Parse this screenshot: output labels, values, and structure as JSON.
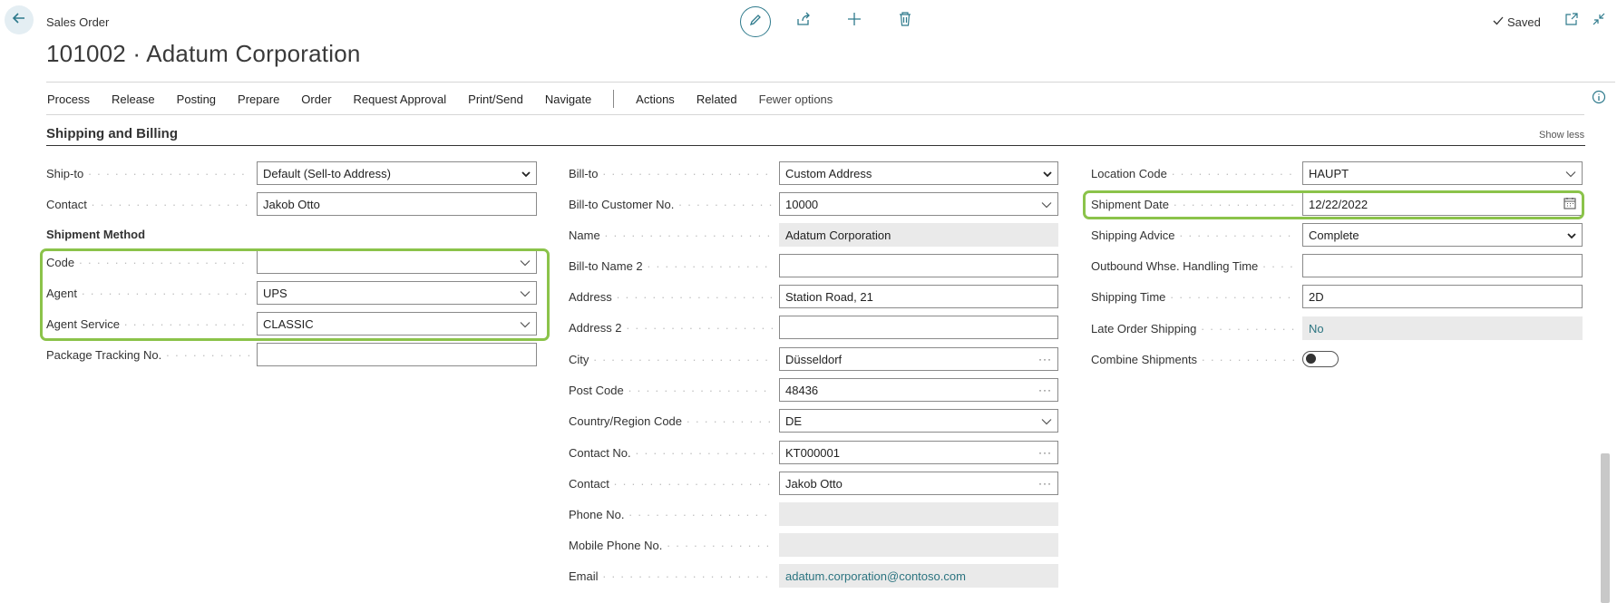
{
  "header": {
    "breadcrumb": "Sales Order",
    "title": "101002 · Adatum Corporation",
    "saved_label": "Saved"
  },
  "actions": {
    "items": [
      "Process",
      "Release",
      "Posting",
      "Prepare",
      "Order",
      "Request Approval",
      "Print/Send",
      "Navigate"
    ],
    "secondary": [
      "Actions",
      "Related",
      "Fewer options"
    ]
  },
  "section": {
    "title": "Shipping and Billing",
    "toggle_label": "Show less"
  },
  "col1": {
    "ship_to_label": "Ship-to",
    "ship_to_value": "Default (Sell-to Address)",
    "contact_label": "Contact",
    "contact_value": "Jakob Otto",
    "shipment_method_header": "Shipment Method",
    "code_label": "Code",
    "code_value": "",
    "agent_label": "Agent",
    "agent_value": "UPS",
    "agent_service_label": "Agent Service",
    "agent_service_value": "CLASSIC",
    "package_tracking_label": "Package Tracking No.",
    "package_tracking_value": ""
  },
  "col2": {
    "bill_to_label": "Bill-to",
    "bill_to_value": "Custom Address",
    "customer_no_label": "Bill-to Customer No.",
    "customer_no_value": "10000",
    "name_label": "Name",
    "name_value": "Adatum Corporation",
    "name2_label": "Bill-to Name 2",
    "name2_value": "",
    "address_label": "Address",
    "address_value": "Station Road, 21",
    "address2_label": "Address 2",
    "address2_value": "",
    "city_label": "City",
    "city_value": "Düsseldorf",
    "post_code_label": "Post Code",
    "post_code_value": "48436",
    "country_label": "Country/Region Code",
    "country_value": "DE",
    "contact_no_label": "Contact No.",
    "contact_no_value": "KT000001",
    "contact_label": "Contact",
    "contact_value": "Jakob Otto",
    "phone_label": "Phone No.",
    "phone_value": "",
    "mobile_label": "Mobile Phone No.",
    "mobile_value": "",
    "email_label": "Email",
    "email_value": "adatum.corporation@contoso.com"
  },
  "col3": {
    "location_label": "Location Code",
    "location_value": "HAUPT",
    "shipment_date_label": "Shipment Date",
    "shipment_date_value": "12/22/2022",
    "shipping_advice_label": "Shipping Advice",
    "shipping_advice_value": "Complete",
    "outbound_label": "Outbound Whse. Handling Time",
    "outbound_value": "",
    "shipping_time_label": "Shipping Time",
    "shipping_time_value": "2D",
    "late_order_label": "Late Order Shipping",
    "late_order_value": "No",
    "combine_label": "Combine Shipments",
    "combine_value": false
  },
  "colors": {
    "accent": "#2e7a8c",
    "highlight": "#8bc34a"
  }
}
